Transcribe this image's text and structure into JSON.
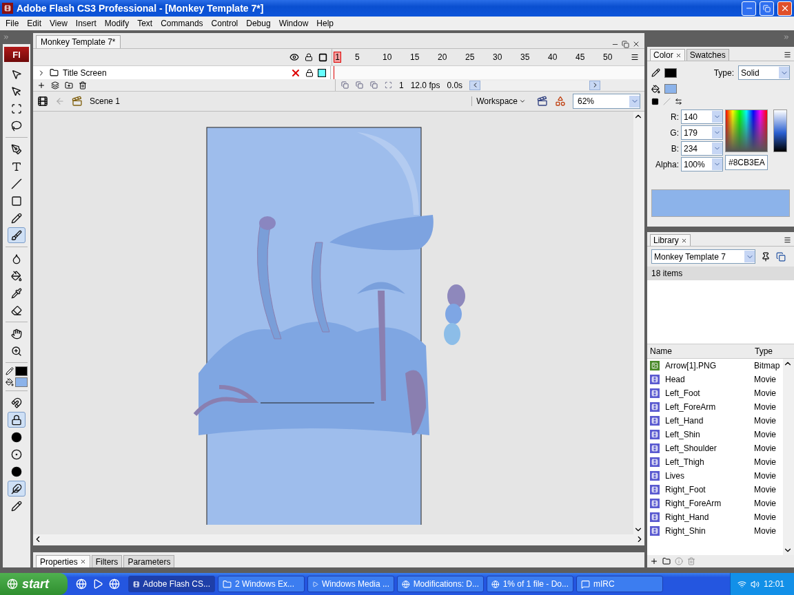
{
  "window": {
    "title": "Adobe Flash CS3 Professional - [Monkey Template 7*]"
  },
  "menu": [
    "File",
    "Edit",
    "View",
    "Insert",
    "Modify",
    "Text",
    "Commands",
    "Control",
    "Debug",
    "Window",
    "Help"
  ],
  "toolbar": {
    "logo": "Fl",
    "groups": [
      [
        {
          "kind": "selection",
          "selected": false
        },
        {
          "kind": "subselection",
          "selected": false
        },
        {
          "kind": "transform",
          "selected": false
        },
        {
          "kind": "lasso",
          "selected": false
        }
      ],
      [
        {
          "kind": "pen",
          "selected": false
        },
        {
          "kind": "text",
          "selected": false
        },
        {
          "kind": "line",
          "selected": false
        },
        {
          "kind": "rectangle",
          "selected": false
        },
        {
          "kind": "pencil",
          "selected": false
        },
        {
          "kind": "brush",
          "selected": true
        }
      ],
      [
        {
          "kind": "inkbottle",
          "selected": false
        },
        {
          "kind": "bucket",
          "selected": false
        },
        {
          "kind": "eyedropper",
          "selected": false
        },
        {
          "kind": "eraser",
          "selected": false
        }
      ],
      [
        {
          "kind": "hand",
          "selected": false
        },
        {
          "kind": "zoom",
          "selected": false
        }
      ],
      [
        {
          "kind": "stroke",
          "color": "#000000"
        },
        {
          "kind": "fill",
          "color": "#8cb3ea"
        }
      ],
      [
        {
          "kind": "snap",
          "selected": false
        },
        {
          "kind": "lockfill",
          "selected": true
        },
        {
          "kind": "object",
          "selected": false
        },
        {
          "kind": "size",
          "selected": false
        },
        {
          "kind": "shape",
          "selected": false
        },
        {
          "kind": "smooth",
          "selected": true
        },
        {
          "kind": "pressure",
          "selected": false
        }
      ]
    ]
  },
  "document_tab": {
    "label": "Monkey Template 7*"
  },
  "timeline": {
    "frames": [
      {
        "label": "1",
        "playhead": true
      },
      {
        "label": "5",
        "playhead": false
      },
      {
        "label": "10",
        "playhead": false
      },
      {
        "label": "15",
        "playhead": false
      },
      {
        "label": "20",
        "playhead": false
      },
      {
        "label": "25",
        "playhead": false
      },
      {
        "label": "30",
        "playhead": false
      },
      {
        "label": "35",
        "playhead": false
      },
      {
        "label": "40",
        "playhead": false
      },
      {
        "label": "45",
        "playhead": false
      },
      {
        "label": "50",
        "playhead": false
      }
    ],
    "layers": [
      {
        "name": "Title Screen",
        "visible": false,
        "locked": true,
        "color": "#66ffff"
      }
    ],
    "current_frame": "1",
    "fps": "12.0 fps",
    "time": "0.0s"
  },
  "edit_bar": {
    "scene": "Scene 1",
    "workspace": "Workspace",
    "zoom": "62%"
  },
  "properties_tabs": [
    {
      "label": "Properties",
      "selected": true
    },
    {
      "label": "Filters",
      "selected": false
    },
    {
      "label": "Parameters",
      "selected": false
    }
  ],
  "color_panel": {
    "tabs": [
      {
        "label": "Color",
        "selected": true
      },
      {
        "label": "Swatches",
        "selected": false
      }
    ],
    "swatches": [
      {
        "kind": "stroke",
        "color": "#000000"
      },
      {
        "kind": "fill",
        "color": "#8cb3ea"
      }
    ],
    "type_label": "Type:",
    "type": "Solid",
    "channels": [
      {
        "label": "R:",
        "value": "140"
      },
      {
        "label": "G:",
        "value": "179"
      },
      {
        "label": "B:",
        "value": "234"
      },
      {
        "label": "Alpha:",
        "value": "100%"
      }
    ],
    "hex": "#8CB3EA"
  },
  "library": {
    "tabs": [
      {
        "label": "Library",
        "selected": true
      }
    ],
    "document": "Monkey Template 7",
    "count": "18 items",
    "columns": [
      "Name",
      "Type"
    ],
    "items": [
      {
        "name": "Arrow[1].PNG",
        "type": "Bitmap",
        "kind": "bitmap"
      },
      {
        "name": "Head",
        "type": "Movie",
        "kind": "movie"
      },
      {
        "name": "Left_Foot",
        "type": "Movie",
        "kind": "movie"
      },
      {
        "name": "Left_ForeArm",
        "type": "Movie",
        "kind": "movie"
      },
      {
        "name": "Left_Hand",
        "type": "Movie",
        "kind": "movie"
      },
      {
        "name": "Left_Shin",
        "type": "Movie",
        "kind": "movie"
      },
      {
        "name": "Left_Shoulder",
        "type": "Movie",
        "kind": "movie"
      },
      {
        "name": "Left_Thigh",
        "type": "Movie",
        "kind": "movie"
      },
      {
        "name": "Lives",
        "type": "Movie",
        "kind": "movie"
      },
      {
        "name": "Right_Foot",
        "type": "Movie",
        "kind": "movie"
      },
      {
        "name": "Right_ForeArm",
        "type": "Movie",
        "kind": "movie"
      },
      {
        "name": "Right_Hand",
        "type": "Movie",
        "kind": "movie"
      },
      {
        "name": "Right_Shin",
        "type": "Movie",
        "kind": "movie"
      }
    ]
  },
  "taskbar": {
    "start": "start",
    "tasks": [
      {
        "label": "Adobe Flash CS...",
        "kind": "flash",
        "selected": true
      },
      {
        "label": "2 Windows Ex...",
        "kind": "folder",
        "selected": false
      },
      {
        "label": "Windows Media ...",
        "kind": "media",
        "selected": false
      },
      {
        "label": "Modifications: D...",
        "kind": "browser",
        "selected": false
      },
      {
        "label": "1% of 1 file - Do...",
        "kind": "browser",
        "selected": false
      },
      {
        "label": "mIRC",
        "kind": "chat",
        "selected": false
      }
    ],
    "clock": "12:01"
  }
}
